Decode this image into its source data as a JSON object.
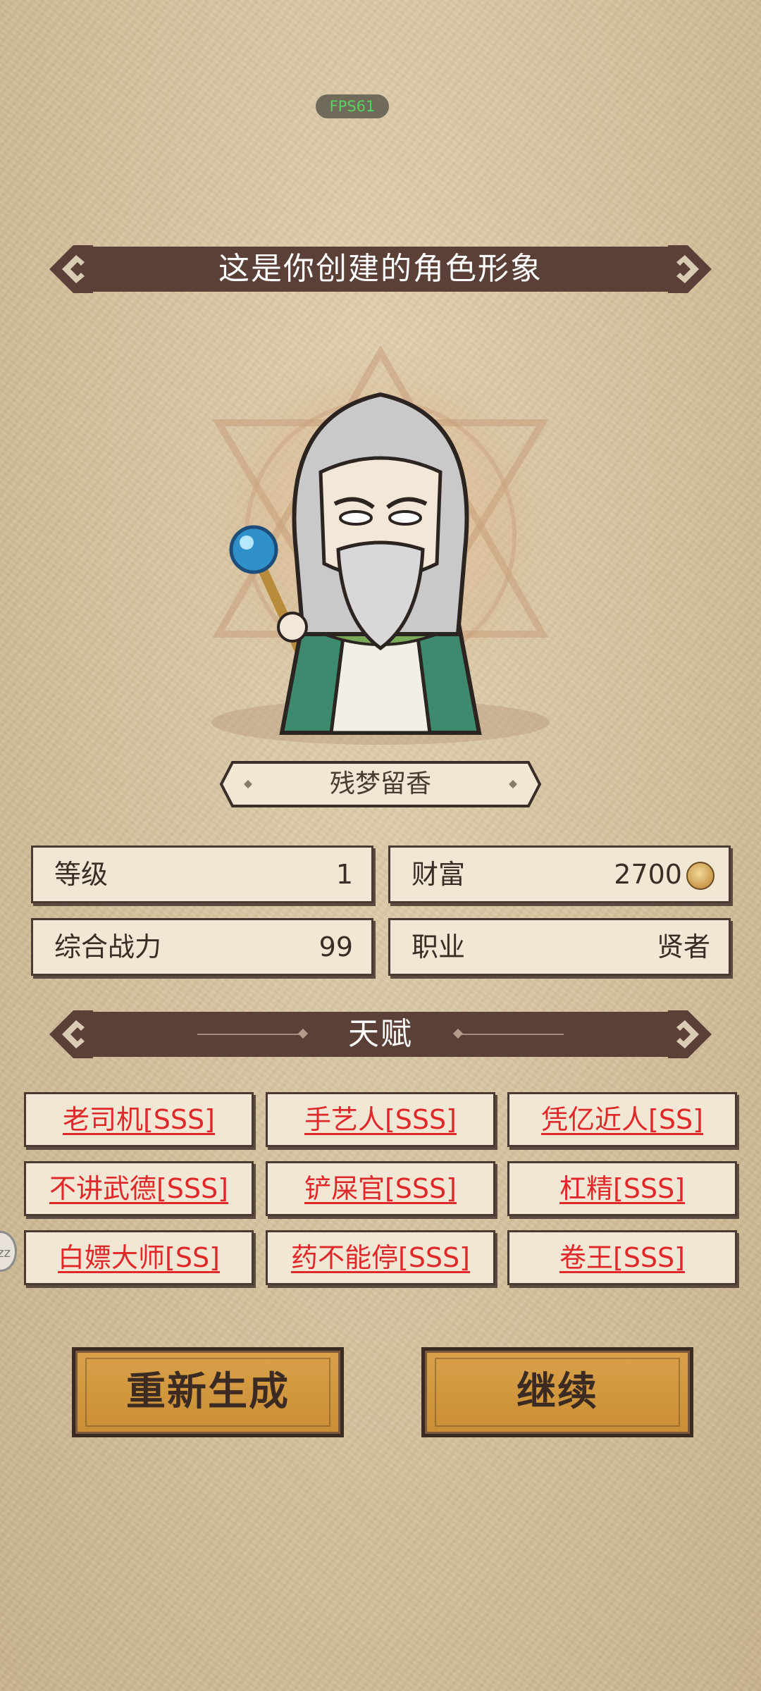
{
  "fps_label": "FPS61",
  "header": {
    "title": "这是你创建的角色形象"
  },
  "character": {
    "name": "残梦留香"
  },
  "stats": {
    "level_label": "等级",
    "level_value": "1",
    "wealth_label": "财富",
    "wealth_value": "2700",
    "power_label": "综合战力",
    "power_value": "99",
    "job_label": "职业",
    "job_value": "贤者"
  },
  "talent_section": {
    "title": "天赋"
  },
  "talents": [
    "老司机[SSS]",
    "手艺人[SSS]",
    "凭亿近人[SS]",
    "不讲武德[SSS]",
    "铲屎官[SSS]",
    "杠精[SSS]",
    "白嫖大师[SS]",
    "药不能停[SSS]",
    "卷王[SSS]"
  ],
  "buttons": {
    "regenerate": "重新生成",
    "continue": "继续"
  },
  "side_handle_label": "zz",
  "colors": {
    "banner": "#5b4038",
    "talent_text": "#e0282a",
    "button": "#d9a24a"
  },
  "icons": [
    "coin-icon",
    "banner-corner-ornament",
    "character-portrait"
  ]
}
